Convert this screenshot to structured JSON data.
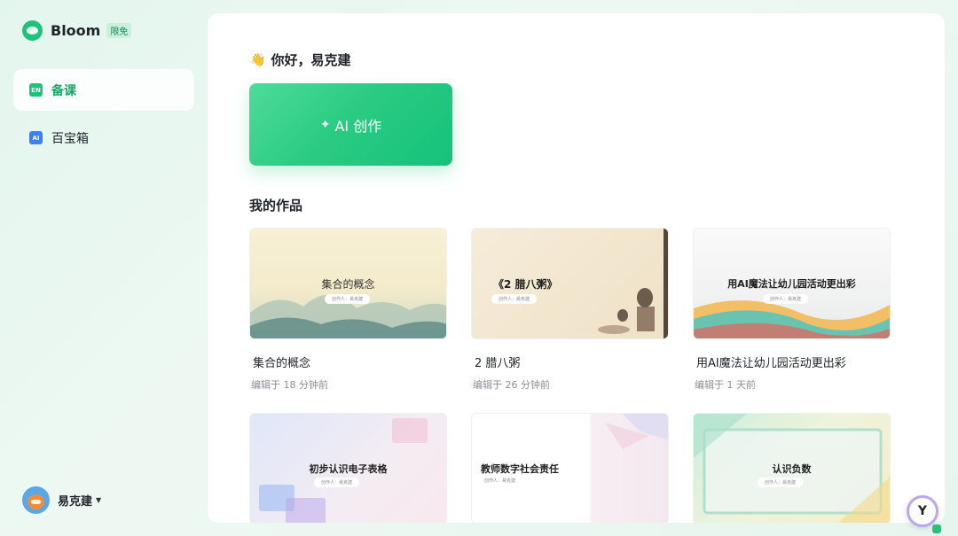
{
  "brand": {
    "name": "Bloom",
    "badge": "限免"
  },
  "sidebar": {
    "items": [
      {
        "icon": "EN",
        "label": "备课",
        "active": true
      },
      {
        "icon": "AI",
        "label": "百宝箱",
        "active": false
      }
    ]
  },
  "user": {
    "name": "易克建"
  },
  "main": {
    "greeting": "你好，易克建",
    "ai_button": "AI 创作",
    "section_title": "我的作品",
    "works": [
      {
        "thumb_title": "集合的概念",
        "creator_label": "创作人：",
        "creator": "易克建",
        "title": "集合的概念",
        "time": "编辑于 18 分钟前"
      },
      {
        "thumb_title": "《2 腊八粥》",
        "creator_label": "创作人：",
        "creator": "易克建",
        "title": "2 腊八粥",
        "time": "编辑于 26 分钟前"
      },
      {
        "thumb_title": "用AI魔法让幼儿园活动更出彩",
        "creator_label": "创作人：",
        "creator": "易克建",
        "title": "用AI魔法让幼儿园活动更出彩",
        "time": "编辑于 1 天前"
      },
      {
        "thumb_title": "初步认识电子表格",
        "creator_label": "创作人：",
        "creator": "易克建",
        "title": "",
        "time": ""
      },
      {
        "thumb_title": "教师数字社会责任",
        "creator_label": "创作人：",
        "creator": "易克建",
        "title": "",
        "time": ""
      },
      {
        "thumb_title": "认识负数",
        "creator_label": "创作人：",
        "creator": "易克建",
        "title": "",
        "time": ""
      }
    ]
  },
  "colors": {
    "accent": "#1fc27a",
    "ai_card_start": "#4ddc9a",
    "ai_card_end": "#15c27a"
  }
}
